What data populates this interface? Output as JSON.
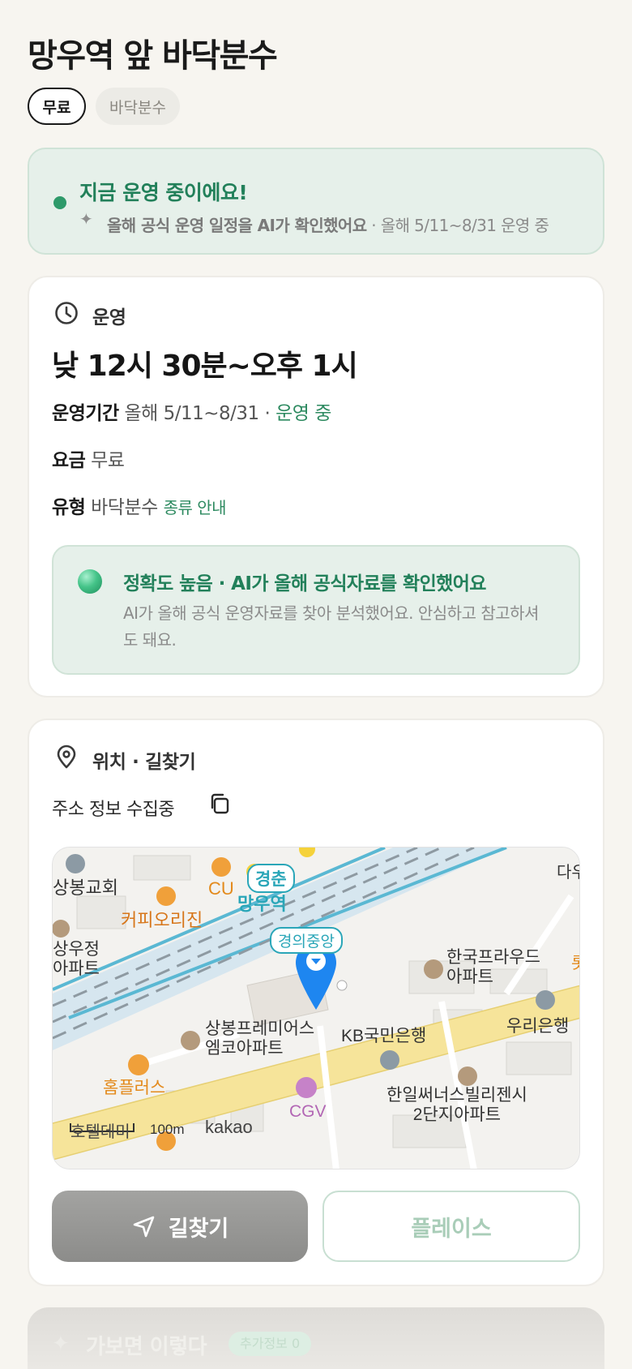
{
  "header": {
    "title": "망우역 앞 바닥분수",
    "chips": [
      "무료",
      "바닥분수"
    ]
  },
  "status": {
    "title": "지금 운영 중이에요!",
    "sub_strong": "올해 공식 운영 일정을 AI가 확인했어요",
    "sub_rest": " · 올해 5/11~8/31 운영 중",
    "color": "#22805a"
  },
  "hours": {
    "section_title": "운영",
    "time": "낮 12시 30분~오후 1시",
    "period_label": "운영기간",
    "period_value": "올해 5/11~8/31 · ",
    "period_status": "운영 중",
    "fee_label": "요금",
    "fee_value": "무료",
    "type_label": "유형",
    "type_value": "바닥분수",
    "type_link": "종류 안내"
  },
  "ai_note": {
    "title": "정확도 높음 · AI가 올해 공식자료를 확인했어요",
    "desc": "AI가 올해 공식 운영자료를 찾아 분석했어요. 안심하고 참고하셔도 돼요."
  },
  "location": {
    "section_title": "위치 · 길찾기",
    "address": "주소 정보 수집중"
  },
  "map": {
    "labels": {
      "church": "상봉교회",
      "cu": "CU",
      "coffee": "커피오리진",
      "station_line1": "경춘",
      "station_line2": "망우역",
      "gyeongui": "경의중앙",
      "apt_left1": "상우정",
      "apt_left2": "아파트",
      "korea_apt1": "한국프라우드",
      "korea_apt2": "아파트",
      "premium1": "상봉프레미어스",
      "premium2": "엠코아파트",
      "kb": "KB국민은행",
      "woori": "우리은행",
      "homeplus": "홈플러스",
      "cgv": "CGV",
      "hanil1": "한일써너스빌리젠시",
      "hanil2": "2단지아파트",
      "hotel": "호텔데미",
      "scale": "100m",
      "brand": "kakao",
      "edge_top_right": "다우",
      "edge_right": "롯"
    },
    "colors": {
      "road": "#f6e49a",
      "rail": "#d6e6ef",
      "marker": "#1e86f0"
    }
  },
  "buttons": {
    "directions": "길찾기",
    "place": "플레이스"
  },
  "peek": {
    "title": "가보면 이렇다",
    "badge": "추가정보 0"
  }
}
